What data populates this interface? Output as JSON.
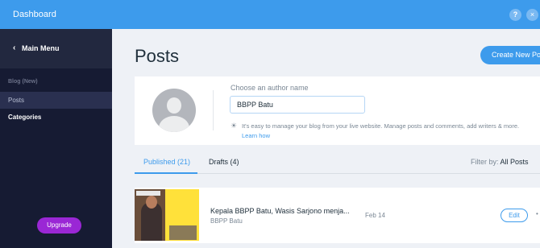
{
  "topbar": {
    "title": "Dashboard",
    "help": "?",
    "close": "×"
  },
  "sidebar": {
    "back_label": "Main Menu",
    "section_label": "Blog (New)",
    "items": [
      {
        "label": "Posts",
        "active": true
      },
      {
        "label": "Categories",
        "active": false
      }
    ],
    "upgrade_label": "Upgrade"
  },
  "main": {
    "title": "Posts",
    "create_label": "Create New Po",
    "author": {
      "label": "Choose an author name",
      "value": "BBPP Batu",
      "tip": "It's easy to manage your blog from your live website. Manage posts and comments, add writers & more.",
      "learn_more": "Learn how"
    },
    "tabs": [
      {
        "label": "Published (21)",
        "active": true
      },
      {
        "label": "Drafts (4)",
        "active": false
      }
    ],
    "filter": {
      "label": "Filter by:",
      "value": "All Posts"
    },
    "posts": [
      {
        "title": "Kepala BBPP Batu, Wasis Sarjono menja...",
        "author": "BBPP Batu",
        "date": "Feb 14",
        "edit_label": "Edit",
        "more": "•"
      }
    ]
  },
  "colors": {
    "accent": "#3d9bec",
    "sidebar": "#161b33",
    "upgrade": "#9a27d5"
  }
}
